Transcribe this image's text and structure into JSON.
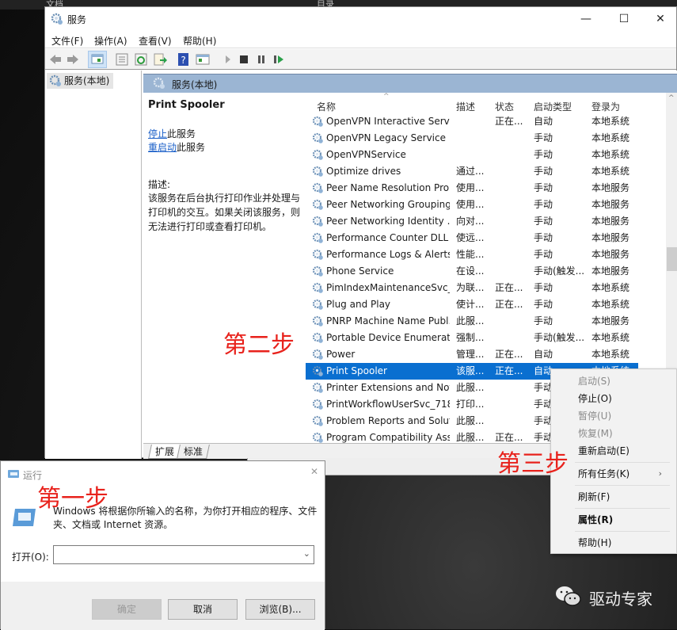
{
  "background_app": {
    "left_label": "文档",
    "right_label": "目录"
  },
  "services_window": {
    "title": "服务",
    "window_controls": {
      "minimize": "—",
      "maximize": "☐",
      "close": "✕"
    },
    "menu": [
      "文件(F)",
      "操作(A)",
      "查看(V)",
      "帮助(H)"
    ],
    "toolbar_icons": [
      "back-icon",
      "forward-icon",
      "show-hide-console-tree-icon",
      "properties-icon",
      "refresh-icon",
      "export-list-icon",
      "help-icon",
      "show-action-pane-icon",
      "start-service-icon",
      "stop-service-icon",
      "pause-service-icon",
      "restart-service-icon"
    ],
    "tree": {
      "root_label": "服务(本地)"
    },
    "content_header": "服务(本地)",
    "detail": {
      "service_name": "Print Spooler",
      "stop_link": "停止",
      "stop_suffix": "此服务",
      "restart_link": "重启动",
      "restart_suffix": "此服务",
      "description_label": "描述:",
      "description": "该服务在后台执行打印作业并处理与打印机的交互。如果关闭该服务，则无法进行打印或查看打印机。"
    },
    "columns": [
      "名称",
      "描述",
      "状态",
      "启动类型",
      "登录为"
    ],
    "rows": [
      {
        "name": "OpenVPN Interactive Servi...",
        "desc": "",
        "status": "正在...",
        "startup": "自动",
        "logon": "本地系统"
      },
      {
        "name": "OpenVPN Legacy Service",
        "desc": "",
        "status": "",
        "startup": "手动",
        "logon": "本地系统"
      },
      {
        "name": "OpenVPNService",
        "desc": "",
        "status": "",
        "startup": "手动",
        "logon": "本地系统"
      },
      {
        "name": "Optimize drives",
        "desc": "通过...",
        "status": "",
        "startup": "手动",
        "logon": "本地系统"
      },
      {
        "name": "Peer Name Resolution Pro...",
        "desc": "使用...",
        "status": "",
        "startup": "手动",
        "logon": "本地服务"
      },
      {
        "name": "Peer Networking Grouping",
        "desc": "使用...",
        "status": "",
        "startup": "手动",
        "logon": "本地服务"
      },
      {
        "name": "Peer Networking Identity ...",
        "desc": "向对...",
        "status": "",
        "startup": "手动",
        "logon": "本地服务"
      },
      {
        "name": "Performance Counter DLL ...",
        "desc": "使远...",
        "status": "",
        "startup": "手动",
        "logon": "本地服务"
      },
      {
        "name": "Performance Logs & Alerts",
        "desc": "性能...",
        "status": "",
        "startup": "手动",
        "logon": "本地服务"
      },
      {
        "name": "Phone Service",
        "desc": "在设...",
        "status": "",
        "startup": "手动(触发...",
        "logon": "本地服务"
      },
      {
        "name": "PimIndexMaintenanceSvc_...",
        "desc": "为联...",
        "status": "正在...",
        "startup": "手动",
        "logon": "本地系统"
      },
      {
        "name": "Plug and Play",
        "desc": "使计...",
        "status": "正在...",
        "startup": "手动",
        "logon": "本地系统"
      },
      {
        "name": "PNRP Machine Name Publ...",
        "desc": "此服...",
        "status": "",
        "startup": "手动",
        "logon": "本地服务"
      },
      {
        "name": "Portable Device Enumerat...",
        "desc": "强制...",
        "status": "",
        "startup": "手动(触发...",
        "logon": "本地系统"
      },
      {
        "name": "Power",
        "desc": "管理...",
        "status": "正在...",
        "startup": "自动",
        "logon": "本地系统"
      },
      {
        "name": "Print Spooler",
        "desc": "该服...",
        "status": "正在...",
        "startup": "自动",
        "logon": "本地系统",
        "selected": true
      },
      {
        "name": "Printer Extensions and Noti...",
        "desc": "此服...",
        "status": "",
        "startup": "手动",
        "logon": ""
      },
      {
        "name": "PrintWorkflowUserSvc_718...",
        "desc": "打印...",
        "status": "",
        "startup": "手动",
        "logon": ""
      },
      {
        "name": "Problem Reports and Solut...",
        "desc": "此服...",
        "status": "",
        "startup": "手动",
        "logon": ""
      },
      {
        "name": "Program Compatibility Assi...",
        "desc": "此服...",
        "status": "正在...",
        "startup": "手动",
        "logon": ""
      }
    ],
    "tabs": [
      "扩展",
      "标准"
    ],
    "active_tab": "扩展"
  },
  "context_menu": {
    "items": [
      {
        "label": "启动(S)",
        "disabled": true
      },
      {
        "label": "停止(O)",
        "disabled": false
      },
      {
        "label": "暂停(U)",
        "disabled": true
      },
      {
        "label": "恢复(M)",
        "disabled": true
      },
      {
        "label": "重新启动(E)",
        "disabled": false
      },
      {
        "label": "所有任务(K)",
        "disabled": false,
        "submenu": true
      },
      {
        "label": "刷新(F)",
        "disabled": false
      },
      {
        "label": "属性(R)",
        "disabled": false,
        "bold": true
      },
      {
        "label": "帮助(H)",
        "disabled": false
      }
    ],
    "submenu_arrow": "›"
  },
  "run_dialog": {
    "title": "运行",
    "close": "✕",
    "message": "Windows 将根据你所输入的名称，为你打开相应的程序、文件夹、文档或 Internet 资源。",
    "open_label": "打开(O):",
    "open_value": "",
    "ok_label": "确定",
    "cancel_label": "取消",
    "browse_label": "浏览(B)..."
  },
  "annotations": {
    "step1": "第一步",
    "step2": "第二步",
    "step3": "第三步"
  },
  "watermark": "驱动专家",
  "colors": {
    "selection": "#0a6fd0",
    "link": "#1a5fc8",
    "header_band": "#9bb5d3",
    "annotation": "#e8221c"
  }
}
